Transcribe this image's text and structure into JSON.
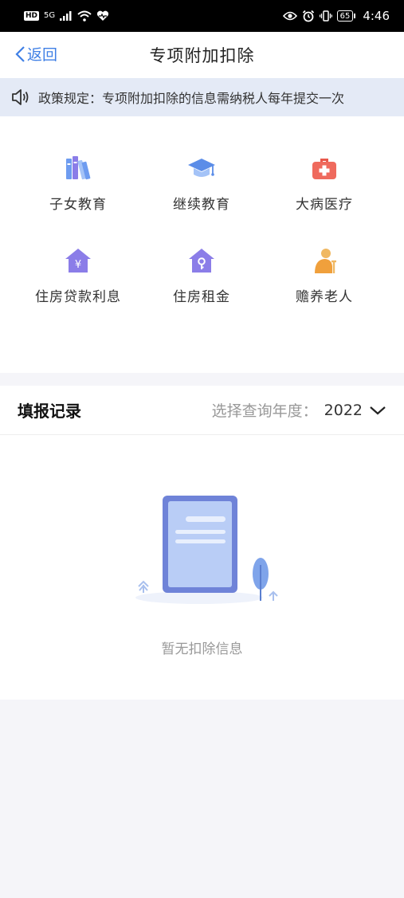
{
  "status_bar": {
    "left_badge": "HD",
    "network": "5G",
    "battery": "65",
    "time": "4:46"
  },
  "nav": {
    "back_label": "返回",
    "title": "专项附加扣除"
  },
  "notice": {
    "text": "政策规定：专项附加扣除的信息需纳税人每年提交一次"
  },
  "categories": [
    {
      "label": "子女教育",
      "icon": "books-icon"
    },
    {
      "label": "继续教育",
      "icon": "graduation-cap-icon"
    },
    {
      "label": "大病医疗",
      "icon": "medical-kit-icon"
    },
    {
      "label": "住房贷款利息",
      "icon": "house-yuan-icon"
    },
    {
      "label": "住房租金",
      "icon": "house-key-icon"
    },
    {
      "label": "赡养老人",
      "icon": "elderly-person-icon"
    }
  ],
  "records": {
    "title": "填报记录",
    "year_label": "选择查询年度：",
    "year_value": "2022",
    "empty_text": "暂无扣除信息"
  },
  "colors": {
    "accent": "#3f7fe5",
    "notice_bg": "#e4eaf6",
    "purple": "#8b7de8",
    "red": "#e8584c"
  }
}
